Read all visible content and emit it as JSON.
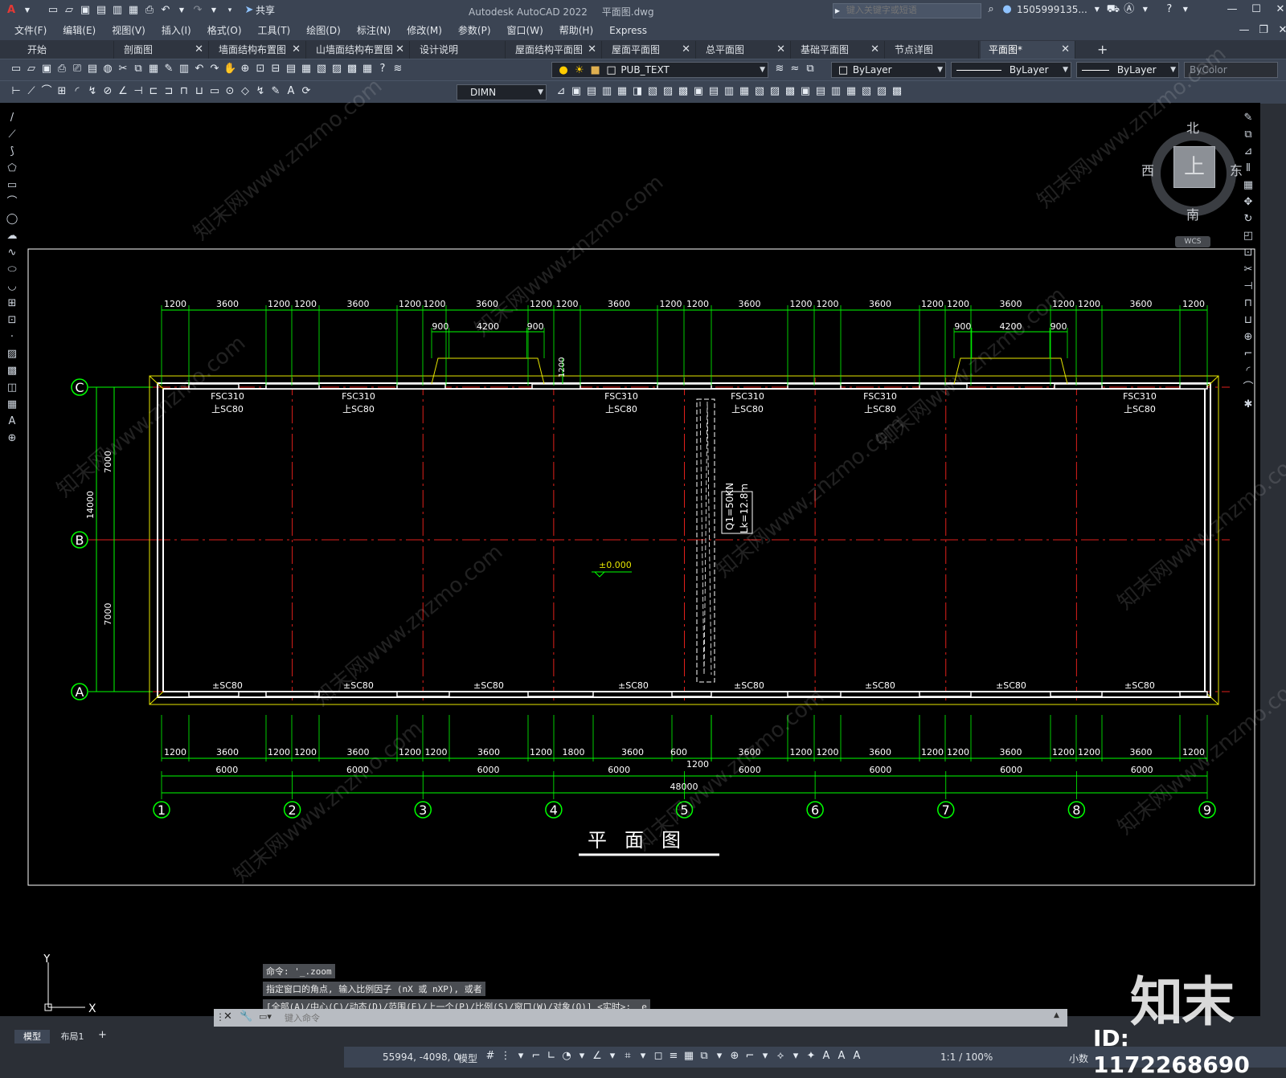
{
  "app": {
    "title": "Autodesk AutoCAD 2022",
    "filename": "平面图.dwg",
    "share": "共享",
    "search_placeholder": "键入关键字或短语",
    "user": "1505999135..."
  },
  "menus": [
    "文件(F)",
    "编辑(E)",
    "视图(V)",
    "插入(I)",
    "格式(O)",
    "工具(T)",
    "绘图(D)",
    "标注(N)",
    "修改(M)",
    "参数(P)",
    "窗口(W)",
    "帮助(H)",
    "Express"
  ],
  "tabs": [
    {
      "label": "开始",
      "closable": false
    },
    {
      "label": "剖面图",
      "closable": true
    },
    {
      "label": "墙面结构布置图",
      "closable": true
    },
    {
      "label": "山墙面结构布置图",
      "closable": true
    },
    {
      "label": "设计说明",
      "closable": false
    },
    {
      "label": "屋面结构平面图",
      "closable": true
    },
    {
      "label": "屋面平面图",
      "closable": true
    },
    {
      "label": "总平面图",
      "closable": true
    },
    {
      "label": "基础平面图",
      "closable": true
    },
    {
      "label": "节点详图",
      "closable": false
    },
    {
      "label": "平面图*",
      "closable": true,
      "active": true
    }
  ],
  "toolbar": {
    "layer": "PUB_TEXT",
    "color": "ByLayer",
    "linetype": "ByLayer",
    "lineweight": "ByLayer",
    "plotstyle": "ByColor",
    "dimstyle": "DIMN"
  },
  "viewcube": {
    "n": "北",
    "s": "南",
    "e": "东",
    "w": "西",
    "top": "上",
    "wcs": "WCS"
  },
  "drawing": {
    "title": "平面图",
    "level": "±0.000",
    "crane": [
      "Q1=50KN",
      "Lk=12.8m"
    ],
    "axes_x": [
      "1",
      "2",
      "3",
      "4",
      "5",
      "6",
      "7",
      "8",
      "9"
    ],
    "axes_y": [
      "C",
      "B",
      "A"
    ],
    "top_dims": [
      "1200",
      "3600",
      "1200",
      "1200",
      "3600",
      "1200",
      "1200",
      "3600",
      "1200",
      "1200",
      "3600",
      "1200",
      "1200",
      "3600",
      "1200",
      "1200",
      "3600",
      "1200",
      "1200",
      "3600",
      "1200",
      "1200",
      "3600",
      "1200"
    ],
    "door_dims": [
      "900",
      "4200",
      "900"
    ],
    "door_height": "1200",
    "bottom_dims": [
      "1200",
      "3600",
      "1200",
      "1200",
      "3600",
      "1200",
      "1200",
      "3600",
      "1200",
      "1800",
      "3600",
      "600",
      "3600",
      "1200",
      "1200",
      "3600",
      "1200",
      "1200",
      "3600",
      "1200",
      "1200",
      "3600",
      "1200"
    ],
    "bottom_extra": "1200",
    "bays": [
      "6000",
      "6000",
      "6000",
      "6000",
      "6000",
      "6000",
      "6000",
      "6000"
    ],
    "total": "48000",
    "left_dims": [
      "7000",
      "14000",
      "7000"
    ],
    "window_top": [
      "FSC310",
      "上SC80"
    ],
    "window_bottom": "±SC80"
  },
  "command": {
    "history": [
      "命令: '_.zoom",
      "指定窗口的角点, 输入比例因子 (nX 或 nXP), 或者",
      "[全部(A)/中心(C)/动态(D)/范围(E)/上一个(P)/比例(S)/窗口(W)/对象(O)] <实时>: _e"
    ],
    "placeholder": "键入命令"
  },
  "layout_tabs": [
    "模型",
    "布局1"
  ],
  "status": {
    "coords": "55994, -4098, 0",
    "mode": "模型",
    "scale": "1:1 / 100%",
    "units": "小数"
  },
  "watermark": {
    "brand": "知末",
    "id": "ID: 1172268690",
    "site": "知末网www.znzmo.com"
  }
}
